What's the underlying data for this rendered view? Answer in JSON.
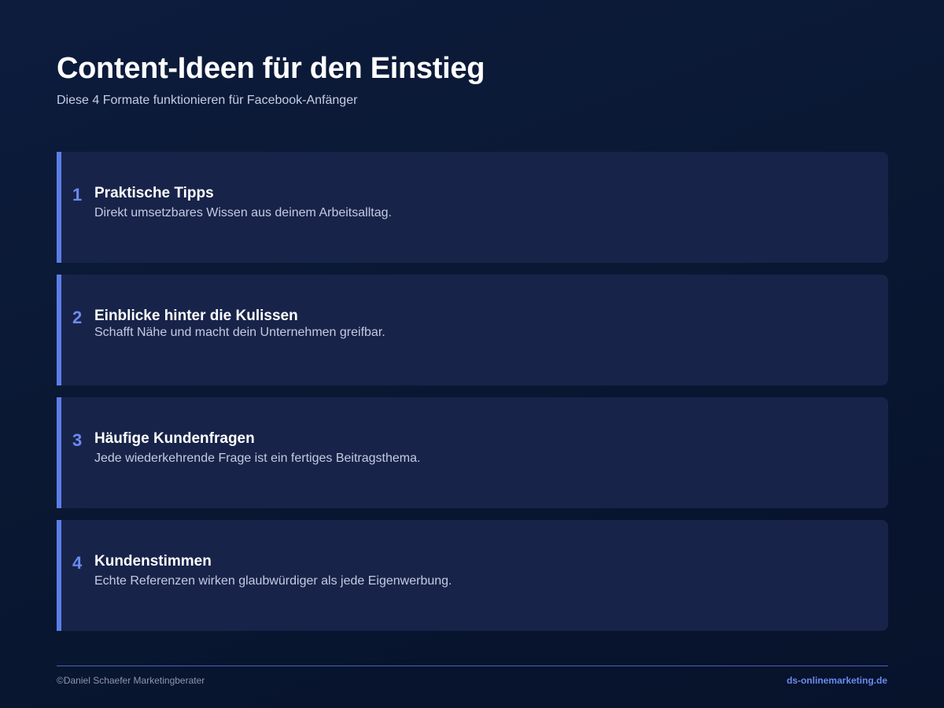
{
  "header": {
    "title": "Content-Ideen für den Einstieg",
    "subtitle": "Diese 4 Formate funktionieren für Facebook-Anfänger"
  },
  "cards": [
    {
      "number": "1",
      "title": "Praktische Tipps",
      "description": "Direkt umsetzbares Wissen aus deinem Arbeitsalltag."
    },
    {
      "number": "2",
      "title": "Einblicke hinter die Kulissen",
      "description": "Schafft Nähe und macht dein Unternehmen greifbar."
    },
    {
      "number": "3",
      "title": "Häufige Kundenfragen",
      "description": "Jede wiederkehrende Frage ist ein fertiges Beitragsthema."
    },
    {
      "number": "4",
      "title": "Kundenstimmen",
      "description": "Echte Referenzen wirken glaubwürdiger als jede Eigenwerbung."
    }
  ],
  "footer": {
    "copyright": "©Daniel Schaefer Marketingberater",
    "website": "ds-onlinemarketing.de"
  },
  "colors": {
    "background": "#0a1833",
    "card": "#182349",
    "accent": "#5b7ee8"
  }
}
